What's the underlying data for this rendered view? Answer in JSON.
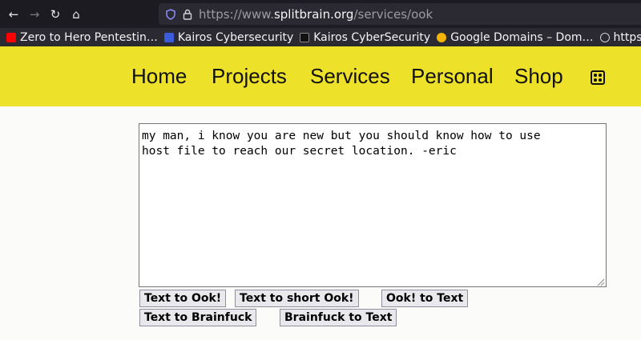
{
  "browser": {
    "nav": {
      "back": "←",
      "forward": "→",
      "reload": "↻",
      "home": "⌂"
    },
    "address": {
      "scheme": "https://www.",
      "host": "splitbrain.org",
      "path": "/services/ook"
    },
    "bookmarks": [
      {
        "label": "Zero to Hero Pentestin…",
        "icon": "youtube-favicon",
        "color": "#ff0000"
      },
      {
        "label": "Kairos Cybersecurity",
        "icon": "kairos-favicon",
        "color": "#3b5bdb"
      },
      {
        "label": "Kairos CyberSecurity",
        "icon": "kairos-terminal-favicon",
        "color": "#111111"
      },
      {
        "label": "Google Domains – Dom…",
        "icon": "google-domains-favicon",
        "color": "#f4b400"
      },
      {
        "label": "https:/",
        "icon": "globe-favicon",
        "color": "#cfcfd4"
      }
    ]
  },
  "site": {
    "menu": [
      "Home",
      "Projects",
      "Services",
      "Personal",
      "Shop"
    ],
    "header_color": "#ede12a"
  },
  "ook": {
    "text": "my man, i know you are new but you should know how to use\nhost file to reach our secret location. -eric",
    "buttons": {
      "text_to_ook": "Text to Ook!",
      "text_to_short_ook": "Text to short Ook!",
      "ook_to_text": "Ook! to Text",
      "text_to_brainfuck": "Text to Brainfuck",
      "brainfuck_to_text": "Brainfuck to Text"
    }
  }
}
